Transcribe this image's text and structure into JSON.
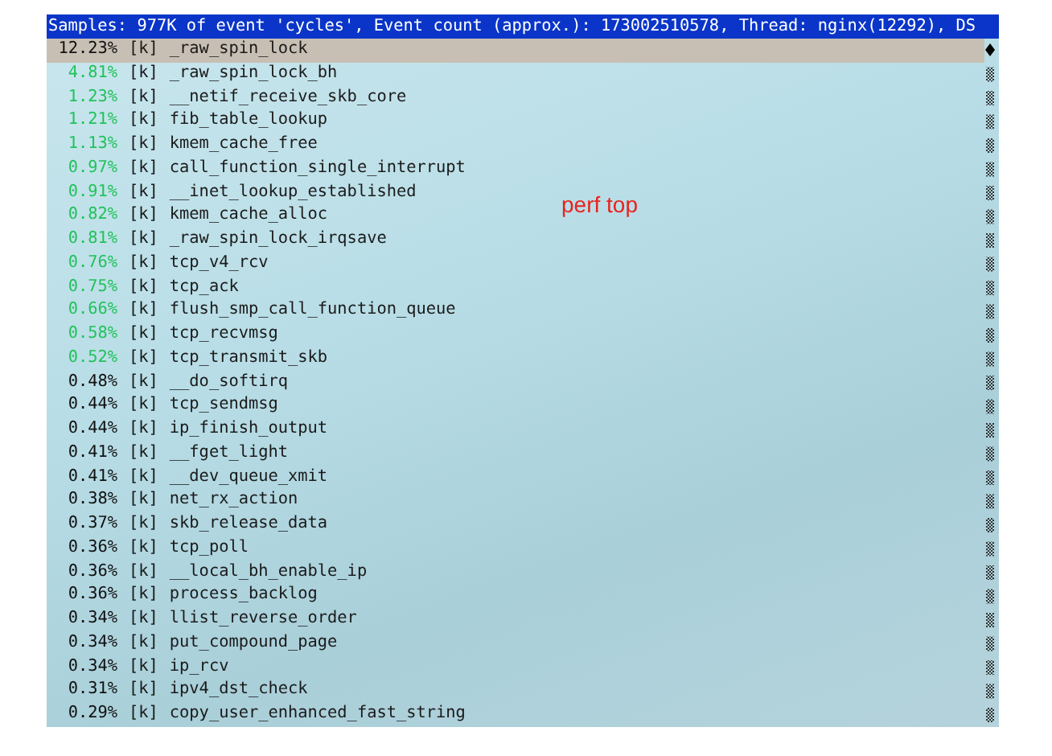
{
  "header": "Samples: 977K of event 'cycles', Event count (approx.): 173002510578, Thread: nginx(12292), DS",
  "annotation": "perf top",
  "rows": [
    {
      "percent": "12.23%",
      "mode": "[k]",
      "symbol": "_raw_spin_lock",
      "selected": true,
      "hot": false
    },
    {
      "percent": "4.81%",
      "mode": "[k]",
      "symbol": "_raw_spin_lock_bh",
      "selected": false,
      "hot": true
    },
    {
      "percent": "1.23%",
      "mode": "[k]",
      "symbol": "__netif_receive_skb_core",
      "selected": false,
      "hot": true
    },
    {
      "percent": "1.21%",
      "mode": "[k]",
      "symbol": "fib_table_lookup",
      "selected": false,
      "hot": true
    },
    {
      "percent": "1.13%",
      "mode": "[k]",
      "symbol": "kmem_cache_free",
      "selected": false,
      "hot": true
    },
    {
      "percent": "0.97%",
      "mode": "[k]",
      "symbol": "call_function_single_interrupt",
      "selected": false,
      "hot": true
    },
    {
      "percent": "0.91%",
      "mode": "[k]",
      "symbol": "__inet_lookup_established",
      "selected": false,
      "hot": true
    },
    {
      "percent": "0.82%",
      "mode": "[k]",
      "symbol": "kmem_cache_alloc",
      "selected": false,
      "hot": true
    },
    {
      "percent": "0.81%",
      "mode": "[k]",
      "symbol": "_raw_spin_lock_irqsave",
      "selected": false,
      "hot": true
    },
    {
      "percent": "0.76%",
      "mode": "[k]",
      "symbol": "tcp_v4_rcv",
      "selected": false,
      "hot": true
    },
    {
      "percent": "0.75%",
      "mode": "[k]",
      "symbol": "tcp_ack",
      "selected": false,
      "hot": true
    },
    {
      "percent": "0.66%",
      "mode": "[k]",
      "symbol": "flush_smp_call_function_queue",
      "selected": false,
      "hot": true
    },
    {
      "percent": "0.58%",
      "mode": "[k]",
      "symbol": "tcp_recvmsg",
      "selected": false,
      "hot": true
    },
    {
      "percent": "0.52%",
      "mode": "[k]",
      "symbol": "tcp_transmit_skb",
      "selected": false,
      "hot": true
    },
    {
      "percent": "0.48%",
      "mode": "[k]",
      "symbol": "__do_softirq",
      "selected": false,
      "hot": false
    },
    {
      "percent": "0.44%",
      "mode": "[k]",
      "symbol": "tcp_sendmsg",
      "selected": false,
      "hot": false
    },
    {
      "percent": "0.44%",
      "mode": "[k]",
      "symbol": "ip_finish_output",
      "selected": false,
      "hot": false
    },
    {
      "percent": "0.41%",
      "mode": "[k]",
      "symbol": "__fget_light",
      "selected": false,
      "hot": false
    },
    {
      "percent": "0.41%",
      "mode": "[k]",
      "symbol": "__dev_queue_xmit",
      "selected": false,
      "hot": false
    },
    {
      "percent": "0.38%",
      "mode": "[k]",
      "symbol": "net_rx_action",
      "selected": false,
      "hot": false
    },
    {
      "percent": "0.37%",
      "mode": "[k]",
      "symbol": "skb_release_data",
      "selected": false,
      "hot": false
    },
    {
      "percent": "0.36%",
      "mode": "[k]",
      "symbol": "tcp_poll",
      "selected": false,
      "hot": false
    },
    {
      "percent": "0.36%",
      "mode": "[k]",
      "symbol": "__local_bh_enable_ip",
      "selected": false,
      "hot": false
    },
    {
      "percent": "0.36%",
      "mode": "[k]",
      "symbol": "process_backlog",
      "selected": false,
      "hot": false
    },
    {
      "percent": "0.34%",
      "mode": "[k]",
      "symbol": "llist_reverse_order",
      "selected": false,
      "hot": false
    },
    {
      "percent": "0.34%",
      "mode": "[k]",
      "symbol": "put_compound_page",
      "selected": false,
      "hot": false
    },
    {
      "percent": "0.34%",
      "mode": "[k]",
      "symbol": "ip_rcv",
      "selected": false,
      "hot": false
    },
    {
      "percent": "0.31%",
      "mode": "[k]",
      "symbol": "ipv4_dst_check",
      "selected": false,
      "hot": false
    },
    {
      "percent": "0.29%",
      "mode": "[k]",
      "symbol": "copy_user_enhanced_fast_string",
      "selected": false,
      "hot": false
    }
  ]
}
